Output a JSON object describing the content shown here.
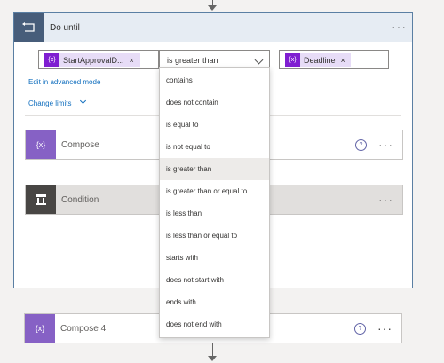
{
  "do_until": {
    "title": "Do until",
    "condition_left_token": "StartApprovalD...",
    "operator_value": "is greater than",
    "condition_right_token": "Deadline",
    "token_icon_text": "{x}",
    "token_remove": "×",
    "edit_advanced_link": "Edit in advanced mode",
    "change_limits_link": "Change limits",
    "more_options": "···"
  },
  "actions": [
    {
      "title": "Compose",
      "icon": "compose-icon",
      "color": "#8661c5"
    },
    {
      "title": "Condition",
      "icon": "condition-icon",
      "color": "#484644"
    }
  ],
  "after_loop_action": {
    "title": "Compose 4",
    "icon": "compose-icon",
    "color": "#8661c5"
  },
  "help_glyph": "?",
  "operator_options": [
    "contains",
    "does not contain",
    "is equal to",
    "is not equal to",
    "is greater than",
    "is greater than or equal to",
    "is less than",
    "is less than or equal to",
    "starts with",
    "does not start with",
    "ends with",
    "does not end with"
  ],
  "selected_option_index": 4,
  "colors": {
    "loop_header_bg": "#e6ecf3",
    "loop_icon_bg": "#475d7a",
    "variable_accent": "#7f1ed1",
    "token_bg": "#e7dcf7",
    "link": "#106ebe"
  }
}
